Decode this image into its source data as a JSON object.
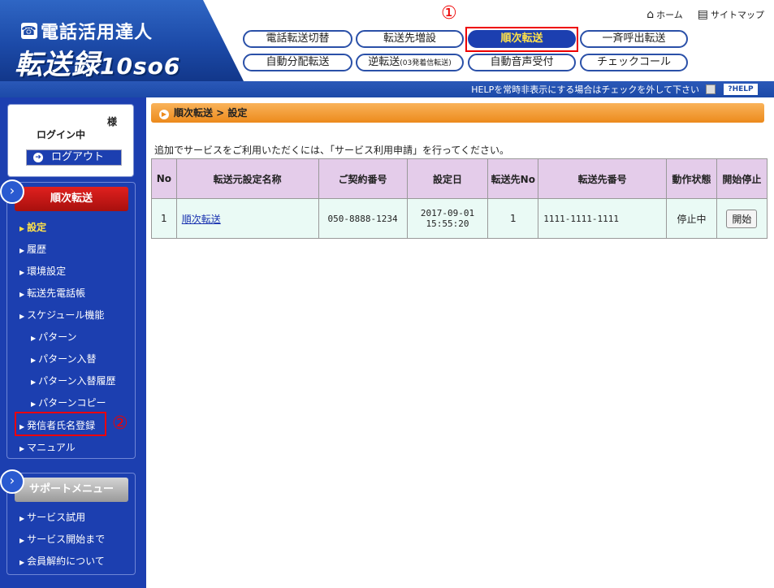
{
  "header": {
    "logo_line1": "電話活用達人",
    "logo_line2_main": "転送録",
    "logo_line2_num": "10so6",
    "home_label": "ホーム",
    "sitemap_label": "サイトマップ"
  },
  "nav": {
    "row1": [
      "電話転送切替",
      "転送先増設",
      "順次転送",
      "一斉呼出転送"
    ],
    "row2": [
      "自動分配転送",
      "逆転送",
      "自動音声受付",
      "チェックコール"
    ],
    "row2_small": "(03発着信転送)",
    "annot1": "①"
  },
  "helpbar": {
    "text": "HELPを常時非表示にする場合はチェックを外して下さい",
    "button": "?HELP"
  },
  "sidebar": {
    "login_sama": "様",
    "login_status": "ログイン中",
    "logout": "ログアウト",
    "section1": "順次転送",
    "menu1": [
      "設定",
      "履歴",
      "環境設定",
      "転送先電話帳",
      "スケジュール機能"
    ],
    "submenu": [
      "パターン",
      "パターン入替",
      "パターン入替履歴",
      "パターンコピー"
    ],
    "menu2": [
      "発信者氏名登録",
      "マニュアル"
    ],
    "annot2": "②",
    "section2": "サポートメニュー",
    "support": [
      "サービス試用",
      "サービス開始まで",
      "会員解約について"
    ]
  },
  "main": {
    "breadcrumb": "順次転送 > 設定",
    "notice": "追加でサービスをご利用いただくには、「サービス利用申請」を行ってください。",
    "columns": [
      "No",
      "転送元設定名称",
      "ご契約番号",
      "設定日",
      "転送先No",
      "転送先番号",
      "動作状態",
      "開始停止"
    ],
    "row": {
      "no": "1",
      "name": "順次転送",
      "contract": "050-8888-1234",
      "date1": "2017-09-01",
      "date2": "15:55:20",
      "dest_no": "1",
      "dest_number": "1111-1111-1111",
      "status": "停止中",
      "action": "開始"
    }
  }
}
